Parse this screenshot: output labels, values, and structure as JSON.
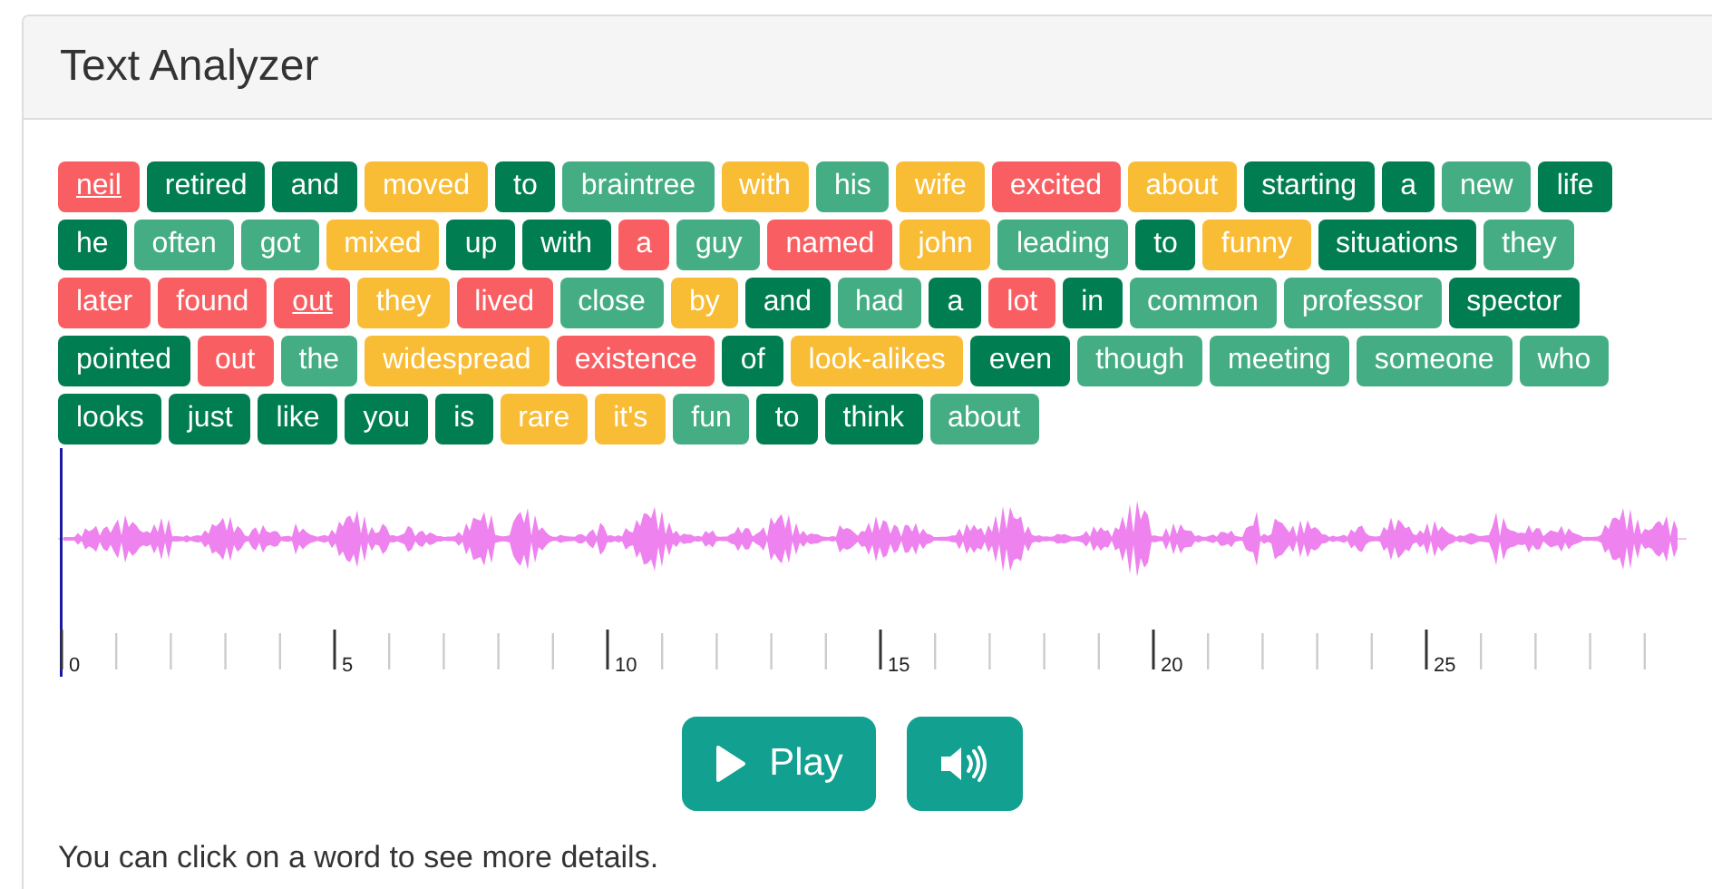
{
  "title": "Text Analyzer",
  "lines": [
    [
      {
        "text": "neil",
        "color": "#f95f62",
        "underlined": true
      },
      {
        "text": "retired",
        "color": "#007e52",
        "underlined": false
      },
      {
        "text": "and",
        "color": "#007e52",
        "underlined": false
      },
      {
        "text": "moved",
        "color": "#f9bc35",
        "underlined": false
      },
      {
        "text": "to",
        "color": "#007e52",
        "underlined": false
      },
      {
        "text": "braintree",
        "color": "#44ad84",
        "underlined": false
      },
      {
        "text": "with",
        "color": "#f9bc35",
        "underlined": false
      },
      {
        "text": "his",
        "color": "#44ad84",
        "underlined": false
      },
      {
        "text": "wife",
        "color": "#f9bc35",
        "underlined": false
      },
      {
        "text": "excited",
        "color": "#f95f62",
        "underlined": false
      },
      {
        "text": "about",
        "color": "#f9bc35",
        "underlined": false
      },
      {
        "text": "starting",
        "color": "#007e52",
        "underlined": false
      },
      {
        "text": "a",
        "color": "#007e52",
        "underlined": false
      },
      {
        "text": "new",
        "color": "#44ad84",
        "underlined": false
      },
      {
        "text": "life",
        "color": "#007e52",
        "underlined": false
      }
    ],
    [
      {
        "text": "he",
        "color": "#007e52",
        "underlined": false
      },
      {
        "text": "often",
        "color": "#44ad84",
        "underlined": false
      },
      {
        "text": "got",
        "color": "#44ad84",
        "underlined": false
      },
      {
        "text": "mixed",
        "color": "#f9bc35",
        "underlined": false
      },
      {
        "text": "up",
        "color": "#007e52",
        "underlined": false
      },
      {
        "text": "with",
        "color": "#007e52",
        "underlined": false
      },
      {
        "text": "a",
        "color": "#f95f62",
        "underlined": false
      },
      {
        "text": "guy",
        "color": "#44ad84",
        "underlined": false
      },
      {
        "text": "named",
        "color": "#f95f62",
        "underlined": false
      },
      {
        "text": "john",
        "color": "#f9bc35",
        "underlined": false
      },
      {
        "text": "leading",
        "color": "#44ad84",
        "underlined": false
      },
      {
        "text": "to",
        "color": "#007e52",
        "underlined": false
      },
      {
        "text": "funny",
        "color": "#f9bc35",
        "underlined": false
      },
      {
        "text": "situations",
        "color": "#007e52",
        "underlined": false
      },
      {
        "text": "they",
        "color": "#44ad84",
        "underlined": false
      }
    ],
    [
      {
        "text": "later",
        "color": "#f95f62",
        "underlined": false
      },
      {
        "text": "found",
        "color": "#f95f62",
        "underlined": false
      },
      {
        "text": "out",
        "color": "#f95f62",
        "underlined": true
      },
      {
        "text": "they",
        "color": "#f9bc35",
        "underlined": false
      },
      {
        "text": "lived",
        "color": "#f95f62",
        "underlined": false
      },
      {
        "text": "close",
        "color": "#44ad84",
        "underlined": false
      },
      {
        "text": "by",
        "color": "#f9bc35",
        "underlined": false
      },
      {
        "text": "and",
        "color": "#007e52",
        "underlined": false
      },
      {
        "text": "had",
        "color": "#44ad84",
        "underlined": false
      },
      {
        "text": "a",
        "color": "#007e52",
        "underlined": false
      },
      {
        "text": "lot",
        "color": "#f95f62",
        "underlined": false
      },
      {
        "text": "in",
        "color": "#007e52",
        "underlined": false
      },
      {
        "text": "common",
        "color": "#44ad84",
        "underlined": false
      },
      {
        "text": "professor",
        "color": "#44ad84",
        "underlined": false
      },
      {
        "text": "spector",
        "color": "#007e52",
        "underlined": false
      }
    ],
    [
      {
        "text": "pointed",
        "color": "#007e52",
        "underlined": false
      },
      {
        "text": "out",
        "color": "#f95f62",
        "underlined": false
      },
      {
        "text": "the",
        "color": "#44ad84",
        "underlined": false
      },
      {
        "text": "widespread",
        "color": "#f9bc35",
        "underlined": false
      },
      {
        "text": "existence",
        "color": "#f95f62",
        "underlined": false
      },
      {
        "text": "of",
        "color": "#007e52",
        "underlined": false
      },
      {
        "text": "look-alikes",
        "color": "#f9bc35",
        "underlined": false
      },
      {
        "text": "even",
        "color": "#007e52",
        "underlined": false
      },
      {
        "text": "though",
        "color": "#44ad84",
        "underlined": false
      },
      {
        "text": "meeting",
        "color": "#44ad84",
        "underlined": false
      },
      {
        "text": "someone",
        "color": "#44ad84",
        "underlined": false
      },
      {
        "text": "who",
        "color": "#44ad84",
        "underlined": false
      }
    ],
    [
      {
        "text": "looks",
        "color": "#007e52",
        "underlined": false
      },
      {
        "text": "just",
        "color": "#007e52",
        "underlined": false
      },
      {
        "text": "like",
        "color": "#007e52",
        "underlined": false
      },
      {
        "text": "you",
        "color": "#007e52",
        "underlined": false
      },
      {
        "text": "is",
        "color": "#007e52",
        "underlined": false
      },
      {
        "text": "rare",
        "color": "#f9bc35",
        "underlined": false
      },
      {
        "text": "it's",
        "color": "#f9bc35",
        "underlined": false
      },
      {
        "text": "fun",
        "color": "#44ad84",
        "underlined": false
      },
      {
        "text": "to",
        "color": "#007e52",
        "underlined": false
      },
      {
        "text": "think",
        "color": "#007e52",
        "underlined": false
      },
      {
        "text": "about",
        "color": "#44ad84",
        "underlined": false
      }
    ]
  ],
  "timeline": {
    "labels": [
      "0",
      "5",
      "10",
      "15",
      "20",
      "25"
    ]
  },
  "play_button": {
    "label": "Play"
  },
  "hint": "You can click on a word to see more details."
}
